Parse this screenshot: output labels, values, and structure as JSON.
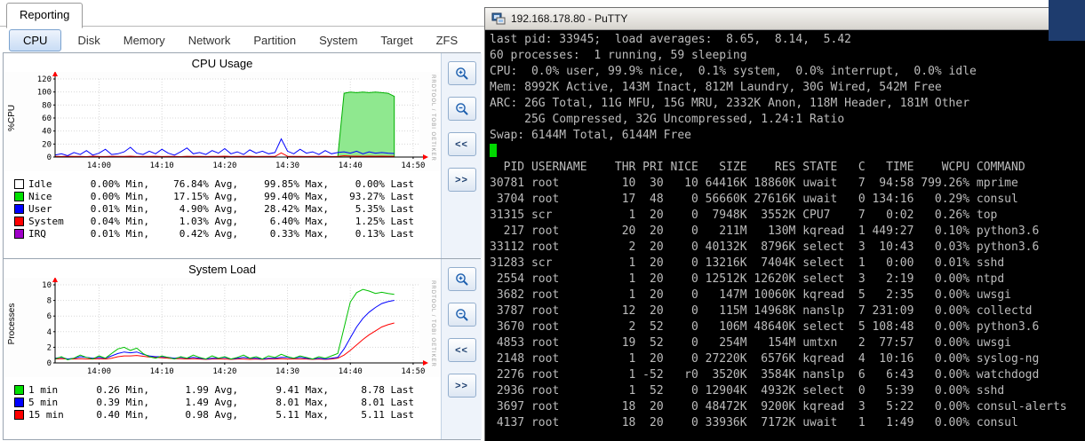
{
  "reporting": {
    "root_tab": "Reporting",
    "tabs": [
      "CPU",
      "Disk",
      "Memory",
      "Network",
      "Partition",
      "System",
      "Target",
      "ZFS"
    ],
    "active_tab": "CPU",
    "zoom_controls": {
      "scroll_left_label": "<<",
      "scroll_right_label": ">>"
    }
  },
  "chart_data": [
    {
      "name": "cpu-usage",
      "type": "line",
      "title": "CPU Usage",
      "ylabel": "%CPU",
      "ylim": [
        0,
        120
      ],
      "yticks": [
        0,
        20,
        40,
        60,
        80,
        100,
        120
      ],
      "x_tick_labels": [
        "14:00",
        "14:10",
        "14:20",
        "14:30",
        "14:40",
        "14:50"
      ],
      "x_tick_minutes": [
        7,
        17,
        27,
        37,
        47,
        57
      ],
      "x_domain_minutes": 58,
      "watermark": "RRDTOOL / TOBI OETIKER",
      "series": [
        {
          "name": "Nice",
          "draw": "area",
          "color": "#00b000",
          "fill": "#8fe88f",
          "values": [
            0,
            0,
            0,
            0,
            0,
            0,
            0,
            0,
            0,
            0,
            0,
            0,
            0,
            0,
            0,
            0,
            0,
            0,
            0,
            0,
            0,
            0,
            0,
            0,
            0,
            0,
            0,
            0,
            0,
            0,
            0,
            0,
            0,
            0,
            0,
            0,
            0,
            0,
            0,
            0,
            0,
            0,
            0,
            0,
            0,
            0,
            98,
            100,
            99,
            100,
            99,
            100,
            99,
            98,
            93.3
          ]
        },
        {
          "name": "System",
          "draw": "line",
          "color": "#ff0000",
          "values": [
            1,
            0.8,
            1.2,
            0.9,
            1.1,
            0.7,
            1.3,
            1,
            0.8,
            1.2,
            1,
            0.9,
            1.4,
            0.8,
            1.1,
            0.9,
            1.2,
            0.8,
            1,
            1.1,
            0.7,
            1.2,
            0.9,
            1,
            0.8,
            1.1,
            0.9,
            1.3,
            0.8,
            1,
            0.9,
            1.2,
            0.8,
            1.1,
            0.9,
            1,
            6.4,
            1.2,
            0.9,
            1.1,
            0.8,
            1,
            0.9,
            1.2,
            0.8,
            1,
            2,
            1.5,
            1.3,
            1.2,
            1.3,
            1.2,
            1.3,
            1.2,
            1.25
          ]
        },
        {
          "name": "User",
          "draw": "line",
          "color": "#0000ff",
          "values": [
            3,
            5,
            2,
            7,
            4,
            10,
            3,
            6,
            12,
            4,
            5,
            8,
            15,
            6,
            4,
            9,
            5,
            12,
            6,
            3,
            8,
            14,
            5,
            7,
            4,
            10,
            6,
            13,
            5,
            8,
            4,
            11,
            6,
            9,
            5,
            7,
            28,
            9,
            5,
            12,
            6,
            8,
            4,
            10,
            5,
            7,
            8,
            6,
            9,
            5,
            8,
            6,
            7,
            6,
            5.4
          ]
        }
      ],
      "legend": [
        {
          "label": "Idle",
          "color": "#ffffff",
          "values": [
            "0.00% Min,",
            "76.84% Avg,",
            "99.85% Max,",
            "0.00% Last"
          ]
        },
        {
          "label": "Nice",
          "color": "#00e000",
          "values": [
            "0.00% Min,",
            "17.15% Avg,",
            "99.40% Max,",
            "93.27% Last"
          ]
        },
        {
          "label": "User",
          "color": "#0000ff",
          "values": [
            "0.01% Min,",
            "4.90% Avg,",
            "28.42% Max,",
            "5.35% Last"
          ]
        },
        {
          "label": "System",
          "color": "#ff0000",
          "values": [
            "0.04% Min,",
            "1.03% Avg,",
            "6.40% Max,",
            "1.25% Last"
          ]
        },
        {
          "label": "IRQ",
          "color": "#9f00c8",
          "values": [
            "0.01% Min,",
            "0.42% Avg,",
            "0.33% Max,",
            "0.13% Last"
          ]
        }
      ]
    },
    {
      "name": "system-load",
      "type": "line",
      "title": "System Load",
      "ylabel": "Processes",
      "ylim": [
        0,
        10
      ],
      "yticks": [
        0,
        2,
        4,
        6,
        8,
        10
      ],
      "x_tick_labels": [
        "14:00",
        "14:10",
        "14:20",
        "14:30",
        "14:40",
        "14:50"
      ],
      "x_tick_minutes": [
        7,
        17,
        27,
        37,
        47,
        57
      ],
      "x_domain_minutes": 58,
      "watermark": "RRDTOOL / TOBI OETIKER",
      "series": [
        {
          "name": "15 min",
          "draw": "line",
          "color": "#ff0000",
          "values": [
            0.5,
            0.55,
            0.5,
            0.5,
            0.55,
            0.5,
            0.5,
            0.55,
            0.5,
            0.6,
            0.8,
            0.9,
            0.9,
            0.95,
            0.85,
            0.75,
            0.7,
            0.65,
            0.6,
            0.55,
            0.55,
            0.5,
            0.55,
            0.5,
            0.45,
            0.5,
            0.5,
            0.5,
            0.45,
            0.5,
            0.5,
            0.45,
            0.5,
            0.45,
            0.5,
            0.5,
            0.55,
            0.5,
            0.5,
            0.5,
            0.5,
            0.45,
            0.5,
            0.45,
            0.5,
            0.6,
            1,
            1.6,
            2.3,
            3,
            3.6,
            4.1,
            4.6,
            4.9,
            5.11
          ]
        },
        {
          "name": "5 min",
          "draw": "line",
          "color": "#0000ff",
          "values": [
            0.6,
            0.7,
            0.5,
            0.6,
            0.8,
            0.7,
            0.6,
            0.7,
            0.6,
            0.9,
            1.2,
            1.4,
            1.3,
            1.4,
            1.1,
            0.9,
            0.8,
            0.8,
            0.7,
            0.6,
            0.7,
            0.6,
            0.7,
            0.6,
            0.5,
            0.6,
            0.6,
            0.7,
            0.5,
            0.6,
            0.7,
            0.6,
            0.6,
            0.5,
            0.6,
            0.6,
            0.7,
            0.7,
            0.6,
            0.7,
            0.6,
            0.5,
            0.6,
            0.5,
            0.6,
            0.7,
            1.8,
            3.2,
            4.6,
            5.7,
            6.5,
            7.1,
            7.6,
            7.85,
            8.01
          ]
        },
        {
          "name": "1 min",
          "draw": "line",
          "color": "#00c000",
          "values": [
            0.5,
            0.8,
            0.4,
            0.6,
            1,
            0.7,
            0.5,
            0.9,
            0.6,
            1.2,
            1.8,
            2,
            1.6,
            1.9,
            1.2,
            0.8,
            0.6,
            0.9,
            0.7,
            0.5,
            0.8,
            0.6,
            1,
            0.7,
            0.5,
            0.9,
            0.6,
            0.8,
            0.5,
            0.7,
            1,
            0.6,
            0.8,
            0.5,
            0.9,
            0.7,
            1.1,
            0.8,
            0.6,
            0.9,
            0.7,
            0.5,
            0.8,
            0.6,
            0.9,
            1.2,
            4.5,
            7.8,
            9,
            9.41,
            9.2,
            8.9,
            9.05,
            8.9,
            8.78
          ]
        }
      ],
      "legend": [
        {
          "label": "1 min",
          "color": "#00e000",
          "values": [
            "0.26 Min,",
            "1.99 Avg,",
            "9.41 Max,",
            "8.78 Last"
          ]
        },
        {
          "label": "5 min",
          "color": "#0000ff",
          "values": [
            "0.39 Min,",
            "1.49 Avg,",
            "8.01 Max,",
            "8.01 Last"
          ]
        },
        {
          "label": "15 min",
          "color": "#ff0000",
          "values": [
            "0.40 Min,",
            "0.98 Avg,",
            "5.11 Max,",
            "5.11 Last"
          ]
        }
      ]
    }
  ],
  "putty": {
    "window_title": "192.168.178.80 - PuTTY",
    "colors": {
      "background": "#000000",
      "foreground": "#bcbcbc",
      "cursor": "#00d800"
    },
    "summary_lines": [
      "last pid: 33945;  load averages:  8.65,  8.14,  5.42",
      "60 processes:  1 running, 59 sleeping",
      "CPU:  0.0% user, 99.9% nice,  0.1% system,  0.0% interrupt,  0.0% idle",
      "Mem: 8992K Active, 143M Inact, 812M Laundry, 30G Wired, 542M Free",
      "ARC: 26G Total, 11G MFU, 15G MRU, 2332K Anon, 118M Header, 181M Other",
      "     25G Compressed, 32G Uncompressed, 1.24:1 Ratio",
      "Swap: 6144M Total, 6144M Free"
    ],
    "table": {
      "columns": [
        "PID",
        "USERNAME",
        "THR",
        "PRI",
        "NICE",
        "SIZE",
        "RES",
        "STATE",
        "C",
        "TIME",
        "WCPU",
        "COMMAND"
      ],
      "rows": [
        [
          "30781",
          "root",
          "10",
          "30",
          "10",
          "64416K",
          "18860K",
          "uwait",
          "7",
          "94:58",
          "799.26%",
          "mprime"
        ],
        [
          "3704",
          "root",
          "17",
          "48",
          "0",
          "56660K",
          "27616K",
          "uwait",
          "0",
          "134:16",
          "0.29%",
          "consul"
        ],
        [
          "31315",
          "scr",
          "1",
          "20",
          "0",
          "7948K",
          "3552K",
          "CPU7",
          "7",
          "0:02",
          "0.26%",
          "top"
        ],
        [
          "217",
          "root",
          "20",
          "20",
          "0",
          "211M",
          "130M",
          "kqread",
          "1",
          "449:27",
          "0.10%",
          "python3.6"
        ],
        [
          "33112",
          "root",
          "2",
          "20",
          "0",
          "40132K",
          "8796K",
          "select",
          "3",
          "10:43",
          "0.03%",
          "python3.6"
        ],
        [
          "31283",
          "scr",
          "1",
          "20",
          "0",
          "13216K",
          "7404K",
          "select",
          "1",
          "0:00",
          "0.01%",
          "sshd"
        ],
        [
          "2554",
          "root",
          "1",
          "20",
          "0",
          "12512K",
          "12620K",
          "select",
          "3",
          "2:19",
          "0.00%",
          "ntpd"
        ],
        [
          "3682",
          "root",
          "1",
          "20",
          "0",
          "147M",
          "10060K",
          "kqread",
          "5",
          "2:35",
          "0.00%",
          "uwsgi"
        ],
        [
          "3787",
          "root",
          "12",
          "20",
          "0",
          "115M",
          "14968K",
          "nanslp",
          "7",
          "231:09",
          "0.00%",
          "collectd"
        ],
        [
          "3670",
          "root",
          "2",
          "52",
          "0",
          "106M",
          "48640K",
          "select",
          "5",
          "108:48",
          "0.00%",
          "python3.6"
        ],
        [
          "4853",
          "root",
          "19",
          "52",
          "0",
          "254M",
          "154M",
          "umtxn",
          "2",
          "77:57",
          "0.00%",
          "uwsgi"
        ],
        [
          "2148",
          "root",
          "1",
          "20",
          "0",
          "27220K",
          "6576K",
          "kqread",
          "4",
          "10:16",
          "0.00%",
          "syslog-ng"
        ],
        [
          "2276",
          "root",
          "1",
          "-52",
          "r0",
          "3520K",
          "3584K",
          "nanslp",
          "6",
          "6:43",
          "0.00%",
          "watchdogd"
        ],
        [
          "2936",
          "root",
          "1",
          "52",
          "0",
          "12904K",
          "4932K",
          "select",
          "0",
          "5:39",
          "0.00%",
          "sshd"
        ],
        [
          "3697",
          "root",
          "18",
          "20",
          "0",
          "48472K",
          "9200K",
          "kqread",
          "3",
          "5:22",
          "0.00%",
          "consul-alerts"
        ],
        [
          "4137",
          "root",
          "18",
          "20",
          "0",
          "33936K",
          "7172K",
          "uwait",
          "1",
          "1:49",
          "0.00%",
          "consul"
        ]
      ]
    }
  },
  "background_window_color": "#1e3c6e"
}
